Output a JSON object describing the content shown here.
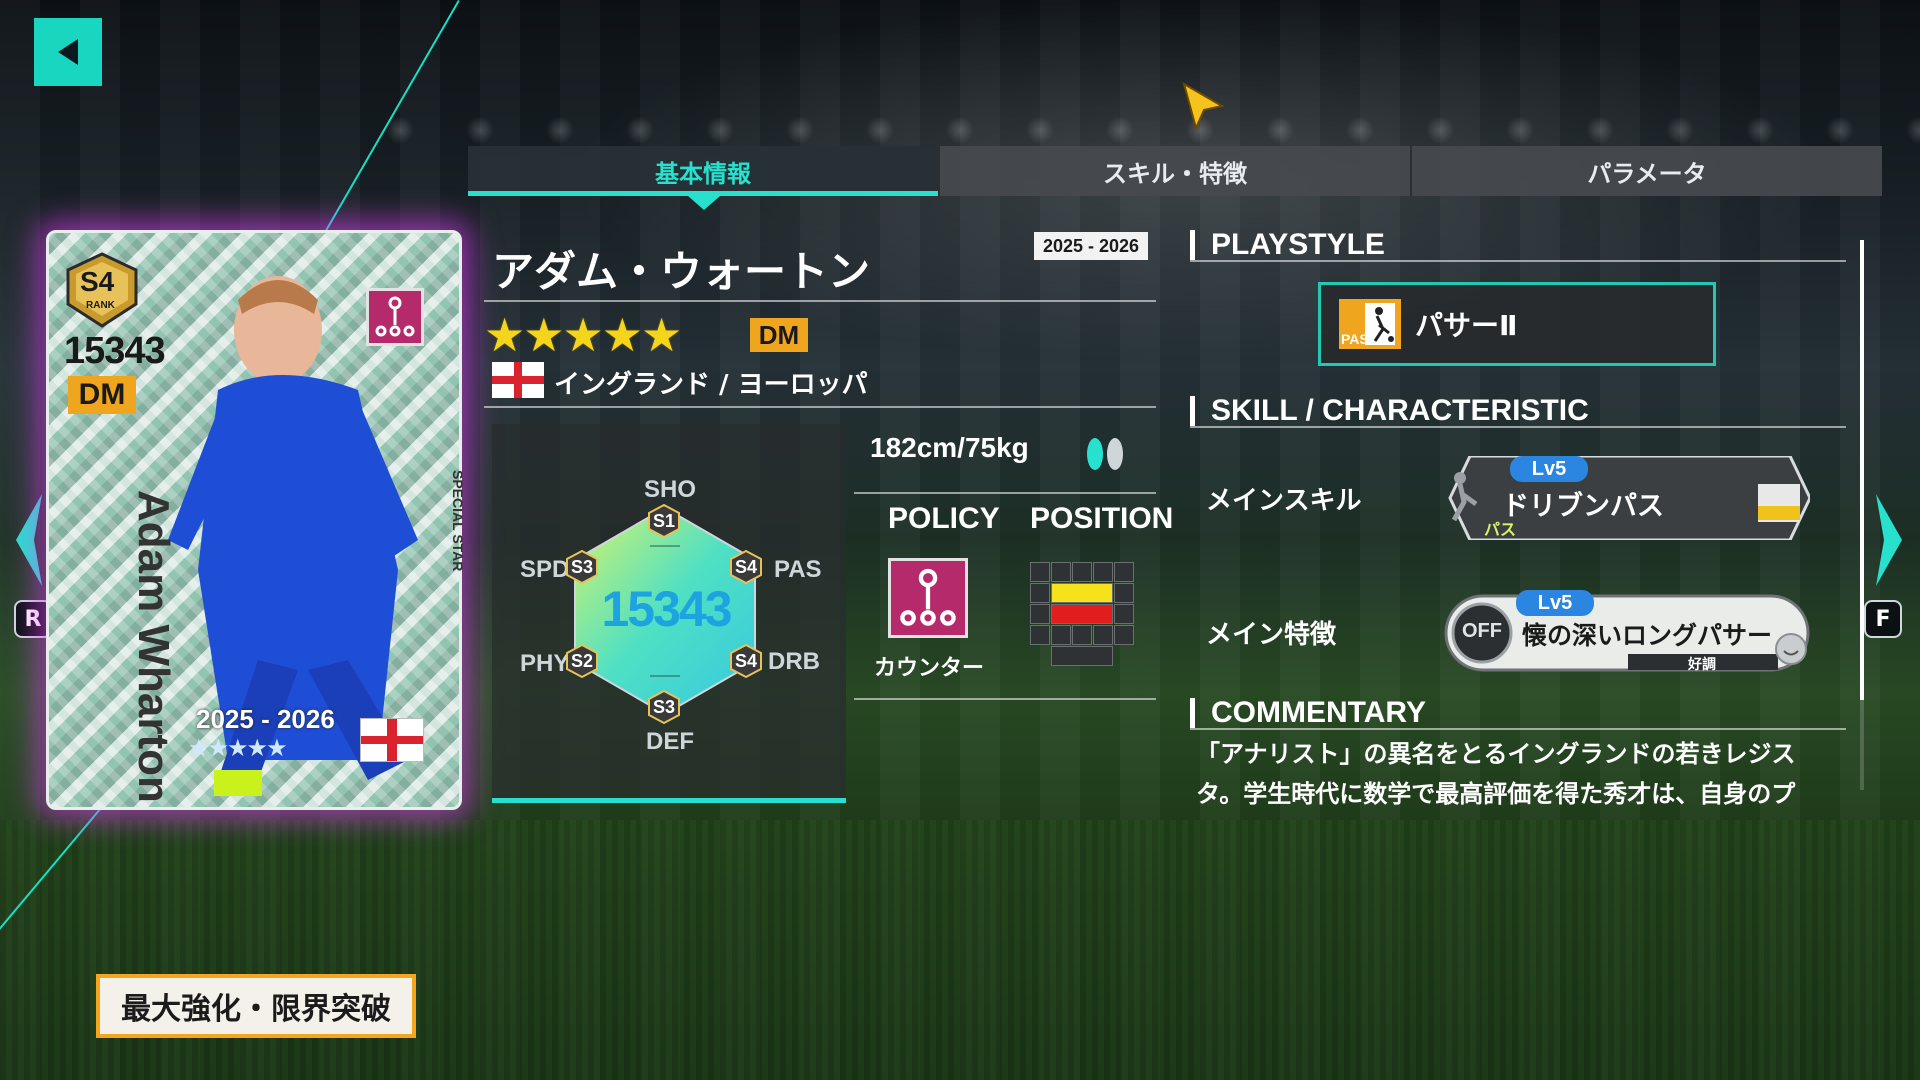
{
  "header": {
    "tabs": [
      {
        "label": "基本情報",
        "active": true
      },
      {
        "label": "スキル・特徴",
        "active": false
      },
      {
        "label": "パラメータ",
        "active": false
      }
    ]
  },
  "nav": {
    "left_key": "R",
    "right_key": "F"
  },
  "card": {
    "rank": "S4",
    "rank_label": "RANK",
    "ovr": "15343",
    "position": "DM",
    "name": "Adam Wharton",
    "season": "2025 - 2026",
    "stars": "★★★★★",
    "side_text": "SPECIAL STAR"
  },
  "player": {
    "name": "アダム・ウォートン",
    "season": "2025 - 2026",
    "stars": "★★★★★",
    "position": "DM",
    "nation": "イングランド / ヨーロッパ",
    "height_weight": "182cm/75kg"
  },
  "stats": {
    "ovr": "15343",
    "labels": {
      "sho": "SHO",
      "pas": "PAS",
      "drb": "DRB",
      "def": "DEF",
      "phy": "PHY",
      "spd": "SPD"
    },
    "grades": {
      "sho": "S1",
      "pas": "S4",
      "drb": "S4",
      "def": "S3",
      "phy": "S2",
      "spd": "S3"
    }
  },
  "policy": {
    "heading": "POLICY",
    "name": "カウンター"
  },
  "position_map": {
    "heading": "POSITION"
  },
  "right_panel": {
    "playstyle_heading": "PLAYSTYLE",
    "playstyle": {
      "name": "パサーⅡ",
      "icon_label": "PAS"
    },
    "skill_heading": "SKILL / CHARACTERISTIC",
    "main_skill_label": "メインスキル",
    "main_skill": {
      "level": "Lv5",
      "name": "ドリブンパス",
      "tag": "パス"
    },
    "main_trait_label": "メイン特徴",
    "main_trait": {
      "level": "Lv5",
      "name": "懐の深いロングパサー",
      "state": "OFF",
      "condition": "好調"
    },
    "commentary_heading": "COMMENTARY",
    "commentary": "「アナリスト」の異名をとるイングランドの若きレジスタ。学生時代に数学で最高評価を得た秀才は、自身のプ"
  },
  "actions": {
    "enhance": "最大強化・限界突破"
  },
  "colors": {
    "accent": "#27e0cd",
    "gold": "#f4d51c",
    "position_badge": "#f0a51e",
    "policy": "#b52a6a"
  }
}
